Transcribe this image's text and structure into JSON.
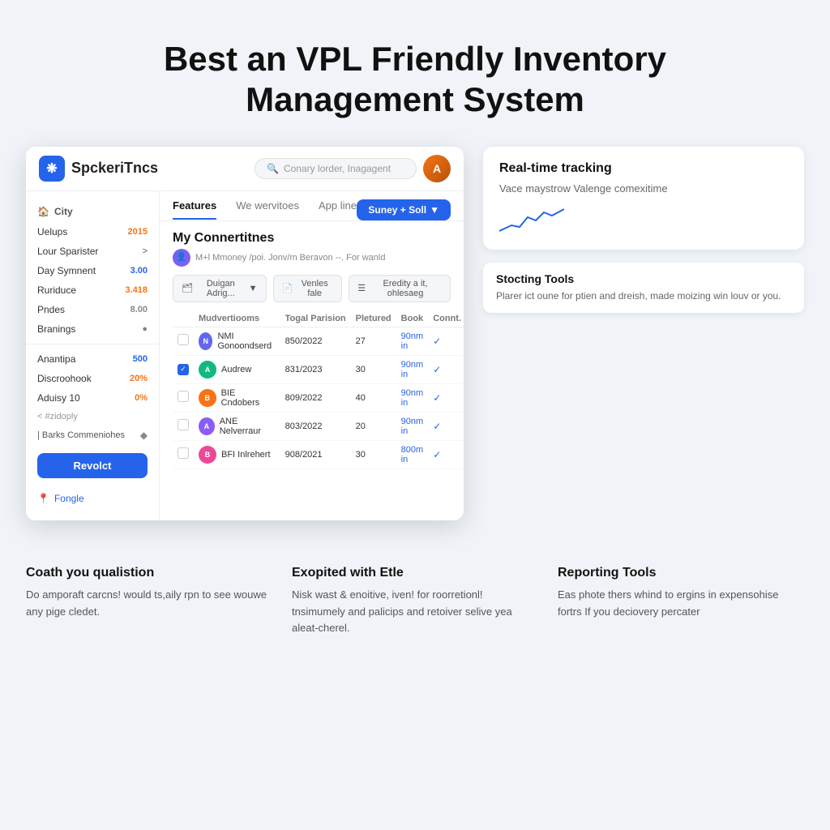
{
  "hero": {
    "title_line1": "Best an VPL Friendly Inventory",
    "title_line2": "Management System"
  },
  "app": {
    "logo_text": "SpckeriTncs",
    "search_placeholder": "Conary lorder, Inagagent",
    "avatar_initials": "A",
    "tabs": [
      {
        "label": "Features",
        "active": true
      },
      {
        "label": "We wervitoes",
        "active": false
      },
      {
        "label": "App line",
        "active": false
      }
    ],
    "action_btn": "Suney + Soll",
    "sidebar": {
      "section_title": "City",
      "items": [
        {
          "label": "Uelups",
          "badge": "2015",
          "badge_type": "orange"
        },
        {
          "label": "Lour Sparister",
          "badge": ">",
          "badge_type": "gray"
        },
        {
          "label": "Day Symnent",
          "badge": "3.00",
          "badge_type": "blue"
        },
        {
          "label": "Ruriduce",
          "badge": "3.418",
          "badge_type": "orange"
        },
        {
          "label": "Pndes",
          "badge": "8.00",
          "badge_type": "gray"
        },
        {
          "label": "Branings",
          "badge": "●",
          "badge_type": "gray"
        }
      ],
      "sub_items": [
        {
          "label": "Anantipa",
          "badge": "500",
          "badge_type": "blue"
        },
        {
          "label": "Discroohook",
          "badge": "20%",
          "badge_type": "orange"
        },
        {
          "label": "Aduisy 10",
          "badge": "0%",
          "badge_type": "orange"
        }
      ],
      "extra": "< #zidoply",
      "barks": "| Barks Commeniohes",
      "btn_label": "Revolct",
      "bottom_link": "Fongle"
    },
    "panel": {
      "title": "My Connertitnes",
      "sub_text": "M+l Mmoney /poi. Jonv/m Beravon --. For wanld",
      "filters": [
        "Duigan Adrig...",
        "Venles fale",
        "Eredity a it, ohlesaeg"
      ],
      "table": {
        "headers": [
          "",
          "Mudvertiooms",
          "Togal Parision",
          "Pletured",
          "Book",
          "Connt. Nov"
        ],
        "rows": [
          {
            "checked": false,
            "name": "NMI Gonoondserd",
            "date": "850/2022",
            "count": "27",
            "link": "90nm in",
            "check": true,
            "avatar_color": "#6366f1"
          },
          {
            "checked": true,
            "name": "Audrew",
            "date": "831/2023",
            "count": "30",
            "link": "90nm in",
            "check": true,
            "avatar_color": "#10b981"
          },
          {
            "checked": false,
            "name": "BIE Cndobers",
            "date": "809/2022",
            "count": "40",
            "link": "90nm in",
            "check": true,
            "avatar_color": "#f97316"
          },
          {
            "checked": false,
            "name": "ANE Nelverraur",
            "date": "803/2022",
            "count": "20",
            "link": "90nm in",
            "check": true,
            "avatar_color": "#8b5cf6"
          },
          {
            "checked": false,
            "name": "BFI Inlrehert",
            "date": "908/2021",
            "count": "30",
            "link": "800m in",
            "check": true,
            "avatar_color": "#ec4899"
          }
        ]
      }
    }
  },
  "features_right": {
    "realtime": {
      "title": "Real-time tracking",
      "desc": "Vace maystrow Valenge comexitime"
    },
    "stocking": {
      "title": "Stocting Tools",
      "desc": "Plarer ict oune for ptien and dreish, made moizing win louv or you."
    }
  },
  "bottom_features": [
    {
      "title": "Coath you qualistion",
      "desc": "Do amporaft carcns! would ts,aily rpn to see wouwe any pige cledet."
    },
    {
      "title": "Exopited with Etle",
      "desc": "Nisk wast & enoitive, iven! for roorretionl! tnsimumely and palicips and retoiver selive yea aleat-cherel."
    },
    {
      "title": "Reporting Tools",
      "desc": "Eas phote thers whind to ergins in expensohise fortrs If you deciovery percater"
    }
  ]
}
